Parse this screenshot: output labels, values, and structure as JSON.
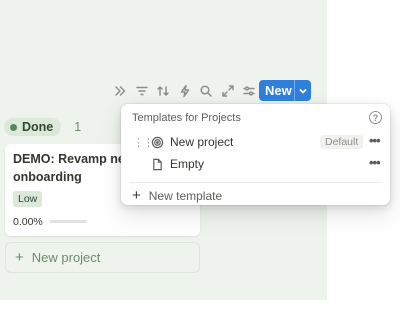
{
  "toolbar": {
    "icons": [
      "chevrons-right-icon",
      "filter-icon",
      "sort-icon",
      "automation-icon",
      "search-icon",
      "expand-icon",
      "settings-icon"
    ],
    "new_label": "New"
  },
  "group": {
    "status_label": "Done",
    "count": "1"
  },
  "card": {
    "title_line1": "DEMO: Revamp new",
    "title_line2": "onboarding",
    "priority": "Low",
    "progress_text": "0.00%",
    "progress_value": 0
  },
  "new_project_label": "New project",
  "menu": {
    "header": "Templates for Projects",
    "items": [
      {
        "label": "New project",
        "badge": "Default",
        "icon": "target-icon"
      },
      {
        "label": "Empty",
        "icon": "page-icon"
      }
    ],
    "new_template_label": "New template"
  },
  "colors": {
    "accent": "#2f7fde",
    "board_bg": "#eef3ed",
    "done_tag": "#dbe8da"
  }
}
